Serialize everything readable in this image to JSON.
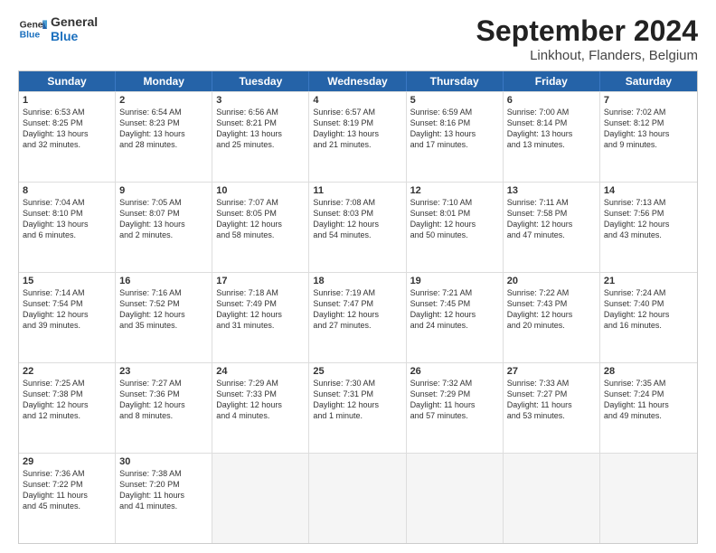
{
  "header": {
    "logo_line1": "General",
    "logo_line2": "Blue",
    "title": "September 2024",
    "subtitle": "Linkhout, Flanders, Belgium"
  },
  "days_of_week": [
    "Sunday",
    "Monday",
    "Tuesday",
    "Wednesday",
    "Thursday",
    "Friday",
    "Saturday"
  ],
  "weeks": [
    [
      {
        "day": "1",
        "info": "Sunrise: 6:53 AM\nSunset: 8:25 PM\nDaylight: 13 hours\nand 32 minutes."
      },
      {
        "day": "2",
        "info": "Sunrise: 6:54 AM\nSunset: 8:23 PM\nDaylight: 13 hours\nand 28 minutes."
      },
      {
        "day": "3",
        "info": "Sunrise: 6:56 AM\nSunset: 8:21 PM\nDaylight: 13 hours\nand 25 minutes."
      },
      {
        "day": "4",
        "info": "Sunrise: 6:57 AM\nSunset: 8:19 PM\nDaylight: 13 hours\nand 21 minutes."
      },
      {
        "day": "5",
        "info": "Sunrise: 6:59 AM\nSunset: 8:16 PM\nDaylight: 13 hours\nand 17 minutes."
      },
      {
        "day": "6",
        "info": "Sunrise: 7:00 AM\nSunset: 8:14 PM\nDaylight: 13 hours\nand 13 minutes."
      },
      {
        "day": "7",
        "info": "Sunrise: 7:02 AM\nSunset: 8:12 PM\nDaylight: 13 hours\nand 9 minutes."
      }
    ],
    [
      {
        "day": "8",
        "info": "Sunrise: 7:04 AM\nSunset: 8:10 PM\nDaylight: 13 hours\nand 6 minutes."
      },
      {
        "day": "9",
        "info": "Sunrise: 7:05 AM\nSunset: 8:07 PM\nDaylight: 13 hours\nand 2 minutes."
      },
      {
        "day": "10",
        "info": "Sunrise: 7:07 AM\nSunset: 8:05 PM\nDaylight: 12 hours\nand 58 minutes."
      },
      {
        "day": "11",
        "info": "Sunrise: 7:08 AM\nSunset: 8:03 PM\nDaylight: 12 hours\nand 54 minutes."
      },
      {
        "day": "12",
        "info": "Sunrise: 7:10 AM\nSunset: 8:01 PM\nDaylight: 12 hours\nand 50 minutes."
      },
      {
        "day": "13",
        "info": "Sunrise: 7:11 AM\nSunset: 7:58 PM\nDaylight: 12 hours\nand 47 minutes."
      },
      {
        "day": "14",
        "info": "Sunrise: 7:13 AM\nSunset: 7:56 PM\nDaylight: 12 hours\nand 43 minutes."
      }
    ],
    [
      {
        "day": "15",
        "info": "Sunrise: 7:14 AM\nSunset: 7:54 PM\nDaylight: 12 hours\nand 39 minutes."
      },
      {
        "day": "16",
        "info": "Sunrise: 7:16 AM\nSunset: 7:52 PM\nDaylight: 12 hours\nand 35 minutes."
      },
      {
        "day": "17",
        "info": "Sunrise: 7:18 AM\nSunset: 7:49 PM\nDaylight: 12 hours\nand 31 minutes."
      },
      {
        "day": "18",
        "info": "Sunrise: 7:19 AM\nSunset: 7:47 PM\nDaylight: 12 hours\nand 27 minutes."
      },
      {
        "day": "19",
        "info": "Sunrise: 7:21 AM\nSunset: 7:45 PM\nDaylight: 12 hours\nand 24 minutes."
      },
      {
        "day": "20",
        "info": "Sunrise: 7:22 AM\nSunset: 7:43 PM\nDaylight: 12 hours\nand 20 minutes."
      },
      {
        "day": "21",
        "info": "Sunrise: 7:24 AM\nSunset: 7:40 PM\nDaylight: 12 hours\nand 16 minutes."
      }
    ],
    [
      {
        "day": "22",
        "info": "Sunrise: 7:25 AM\nSunset: 7:38 PM\nDaylight: 12 hours\nand 12 minutes."
      },
      {
        "day": "23",
        "info": "Sunrise: 7:27 AM\nSunset: 7:36 PM\nDaylight: 12 hours\nand 8 minutes."
      },
      {
        "day": "24",
        "info": "Sunrise: 7:29 AM\nSunset: 7:33 PM\nDaylight: 12 hours\nand 4 minutes."
      },
      {
        "day": "25",
        "info": "Sunrise: 7:30 AM\nSunset: 7:31 PM\nDaylight: 12 hours\nand 1 minute."
      },
      {
        "day": "26",
        "info": "Sunrise: 7:32 AM\nSunset: 7:29 PM\nDaylight: 11 hours\nand 57 minutes."
      },
      {
        "day": "27",
        "info": "Sunrise: 7:33 AM\nSunset: 7:27 PM\nDaylight: 11 hours\nand 53 minutes."
      },
      {
        "day": "28",
        "info": "Sunrise: 7:35 AM\nSunset: 7:24 PM\nDaylight: 11 hours\nand 49 minutes."
      }
    ],
    [
      {
        "day": "29",
        "info": "Sunrise: 7:36 AM\nSunset: 7:22 PM\nDaylight: 11 hours\nand 45 minutes."
      },
      {
        "day": "30",
        "info": "Sunrise: 7:38 AM\nSunset: 7:20 PM\nDaylight: 11 hours\nand 41 minutes."
      },
      {
        "day": "",
        "info": ""
      },
      {
        "day": "",
        "info": ""
      },
      {
        "day": "",
        "info": ""
      },
      {
        "day": "",
        "info": ""
      },
      {
        "day": "",
        "info": ""
      }
    ]
  ]
}
